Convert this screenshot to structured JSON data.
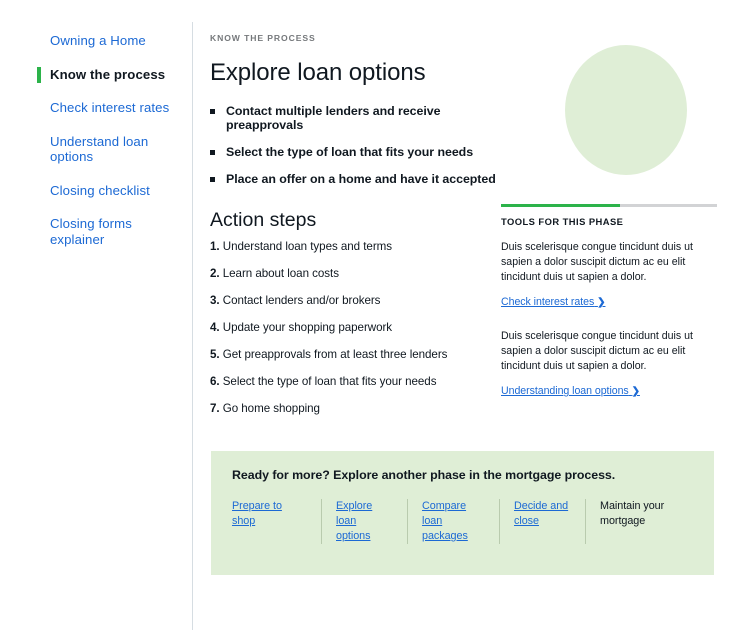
{
  "sidebar": {
    "items": [
      {
        "label": "Owning a Home",
        "active": false
      },
      {
        "label": "Know the process",
        "active": true
      },
      {
        "label": "Check interest rates",
        "active": false
      },
      {
        "label": "Understand loan options",
        "active": false
      },
      {
        "label": "Closing checklist",
        "active": false
      },
      {
        "label": "Closing forms explainer",
        "active": false
      }
    ]
  },
  "main": {
    "eyebrow": "KNOW THE PROCESS",
    "title": "Explore loan options",
    "bullets": [
      "Contact multiple lenders and receive preapprovals",
      "Select the type of loan that fits your needs",
      "Place an offer on a home and have it accepted"
    ],
    "action_heading": "Action steps",
    "steps": [
      "Understand loan types and terms",
      "Learn about loan costs",
      "Contact lenders and/or brokers",
      "Update your shopping paperwork",
      "Get preapprovals from at least three lenders",
      "Select the type of loan that fits your needs",
      "Go home shopping"
    ]
  },
  "tools": {
    "title": "TOOLS FOR THIS PHASE",
    "progress_percent": 55,
    "blocks": [
      {
        "body": "Duis scelerisque congue tincidunt duis ut sapien a dolor suscipit dictum ac eu elit tincidunt duis ut sapien a dolor.",
        "link": "Check interest rates",
        "chevron": "❯"
      },
      {
        "body": "Duis scelerisque congue tincidunt duis ut sapien a dolor suscipit dictum ac eu elit tincidunt duis ut sapien a dolor.",
        "link": "Understanding loan options",
        "chevron": "❯"
      }
    ]
  },
  "cta": {
    "heading": "Ready for more? Explore another phase in the mortgage process.",
    "links": [
      {
        "label": "Prepare to shop",
        "is_link": true
      },
      {
        "label": "Explore loan options",
        "is_link": true
      },
      {
        "label": "Compare loan packages",
        "is_link": true
      },
      {
        "label": "Decide and close",
        "is_link": true
      },
      {
        "label": "Maintain your mortgage",
        "is_link": false
      }
    ]
  },
  "colors": {
    "accent_green": "#2cb34a",
    "panel_green": "#dfeed6",
    "link_blue": "#1c69d4",
    "text_dark": "#101820",
    "muted_gray": "#75787b"
  }
}
